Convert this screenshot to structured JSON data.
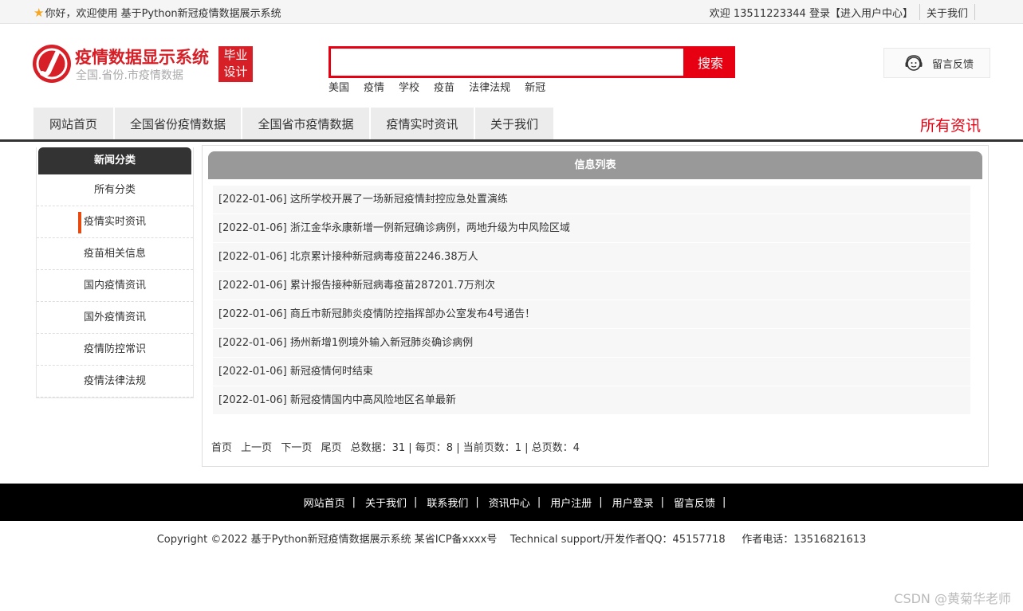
{
  "topbar": {
    "welcome": "你好，欢迎使用 基于Python新冠疫情数据展示系统",
    "user_greeting": "欢迎 13511223344 登录",
    "user_center": "【进入用户中心】",
    "about": "关于我们"
  },
  "logo": {
    "title": "疫情数据显示系统",
    "subtitle": "全国.省份.市疫情数据",
    "badge_line1": "毕业",
    "badge_line2": "设计"
  },
  "search": {
    "value": "",
    "button": "搜索",
    "hot_words": [
      "美国",
      "疫情",
      "学校",
      "疫苗",
      "法律法规",
      "新冠"
    ]
  },
  "feedback": {
    "label": "留言反馈"
  },
  "nav": {
    "items": [
      "网站首页",
      "全国省份疫情数据",
      "全国省市疫情数据",
      "疫情实时资讯",
      "关于我们"
    ],
    "section_title": "所有资讯"
  },
  "sidebar": {
    "title": "新闻分类",
    "items": [
      "所有分类",
      "疫情实时资讯",
      "疫苗相关信息",
      "国内疫情资讯",
      "国外疫情资讯",
      "疫情防控常识",
      "疫情法律法规"
    ],
    "active_index": 1
  },
  "main": {
    "title": "信息列表",
    "news": [
      "[2022-01-06] 这所学校开展了一场新冠疫情封控应急处置演练",
      "[2022-01-06] 浙江金华永康新增一例新冠确诊病例，两地升级为中风险区域",
      "[2022-01-06] 北京累计接种新冠病毒疫苗2246.38万人",
      "[2022-01-06] 累计报告接种新冠病毒疫苗287201.7万剂次",
      "[2022-01-06] 商丘市新冠肺炎疫情防控指挥部办公室发布4号通告！",
      "[2022-01-06] 扬州新增1例境外输入新冠肺炎确诊病例",
      "[2022-01-06] 新冠疫情何时结束",
      "[2022-01-06] 新冠疫情国内中高风险地区名单最新"
    ],
    "pager": {
      "first": "首页",
      "prev": "上一页",
      "next": "下一页",
      "last": "尾页",
      "info": "总数据：31 | 每页：8 | 当前页数：1 | 总页数：4"
    }
  },
  "footer": {
    "links": [
      "网站首页",
      "关于我们",
      "联系我们",
      "资讯中心",
      "用户注册",
      "用户登录",
      "留言反馈"
    ],
    "separator": "|",
    "copyright": "Copyright ©2022 基于Python新冠疫情数据展示系统 某省ICP备xxxx号    Technical support/开发作者QQ：45157718     作者电话：13516821613"
  },
  "watermark": "CSDN @黄菊华老师",
  "colors": {
    "brand_red": "#e60012",
    "logo_red": "#d61f26",
    "active_marker": "#e8490f"
  }
}
